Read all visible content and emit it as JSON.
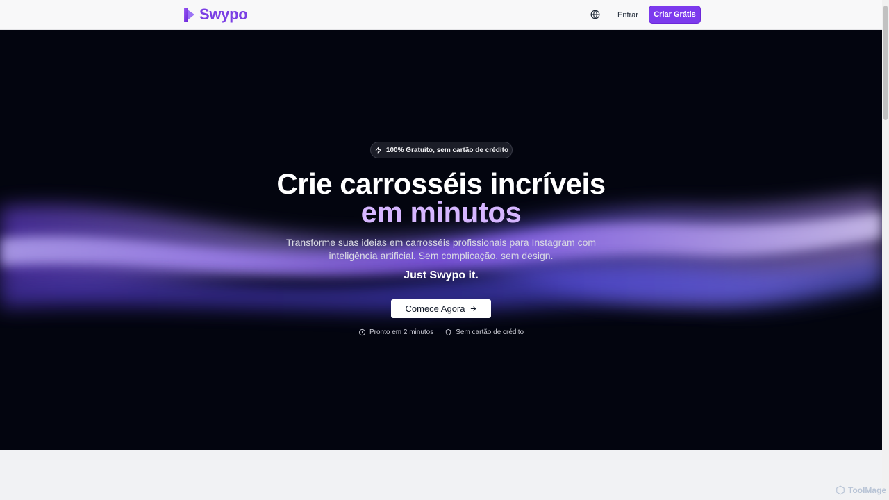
{
  "header": {
    "brand": "Swypo",
    "language_icon": "globe-icon",
    "login_label": "Entrar",
    "signup_label": "Criar Grátis",
    "accent_color": "#7c3aed"
  },
  "hero": {
    "badge": {
      "icon": "lightning-icon",
      "text": "100% Gratuito, sem cartão de crédito"
    },
    "title_line1": "Crie carrosséis incríveis",
    "title_line2": "em minutos",
    "subtitle_line1": "Transforme suas ideias em carrosséis profissionais para Instagram com",
    "subtitle_line2": "inteligência artificial. Sem complicação, sem design.",
    "tagline": "Just Swypo it.",
    "cta_label": "Comece Agora",
    "cta_icon": "arrow-right-icon",
    "features": [
      {
        "icon": "clock-icon",
        "text": "Pronto em 2 minutos"
      },
      {
        "icon": "shield-icon",
        "text": "Sem cartão de crédito"
      }
    ],
    "background_color": "#03050f",
    "wave_color": "#8b5cf6"
  },
  "watermark": {
    "text": "ToolMage"
  }
}
